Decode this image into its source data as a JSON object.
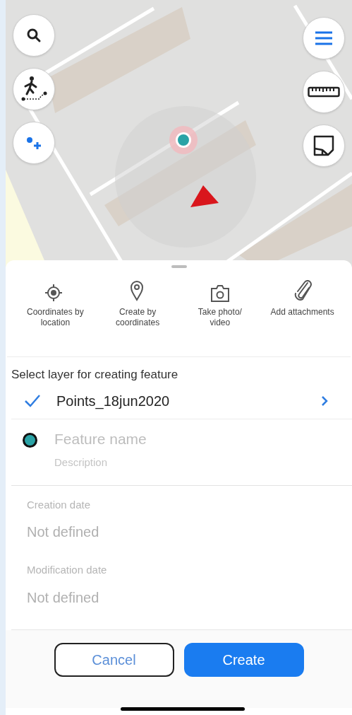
{
  "map_controls": {
    "left": [
      {
        "kind": "search"
      },
      {
        "kind": "track"
      },
      {
        "kind": "add-point"
      }
    ],
    "right": [
      {
        "kind": "menu"
      },
      {
        "kind": "ruler"
      },
      {
        "kind": "note"
      }
    ]
  },
  "actions": [
    {
      "kind": "gps",
      "label": "Coordinates by location"
    },
    {
      "kind": "xy",
      "label": "Create by coordinates"
    },
    {
      "kind": "camera",
      "label": "Take photo/ video"
    },
    {
      "kind": "clip",
      "label": "Add attachments"
    }
  ],
  "layer_section": {
    "title": "Select layer for creating feature",
    "layer": {
      "name": "Points_18jun2020",
      "checked": true
    }
  },
  "feature": {
    "color": "#2aa3a6",
    "name_placeholder": "Feature name",
    "description_placeholder": "Description"
  },
  "dates": [
    {
      "label": "Creation date",
      "value": "Not defined"
    },
    {
      "label": "Modification date",
      "value": "Not defined"
    }
  ],
  "buttons": [
    {
      "kind": "secondary",
      "label": "Cancel"
    },
    {
      "kind": "primary",
      "label": "Create"
    }
  ]
}
